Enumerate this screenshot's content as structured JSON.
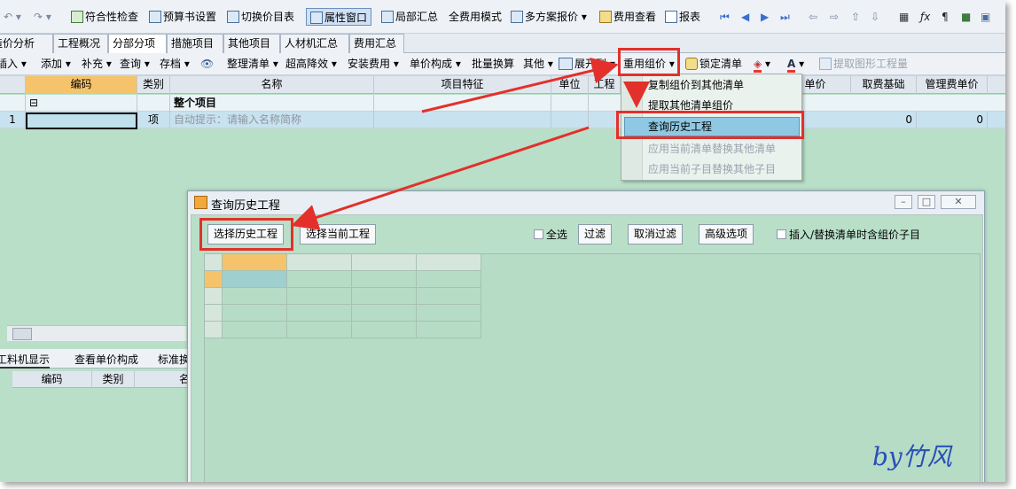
{
  "toolbar1": {
    "compliance_check": "符合性检查",
    "budget_settings": "预算书设置",
    "switch_price_table": "切换价目表",
    "property_window": "属性窗口",
    "partial_summary": "局部汇总",
    "full_fee_mode": "全费用模式",
    "multi_plan_quote": "多方案报价",
    "fee_view": "费用查看",
    "report": "报表"
  },
  "tabs": [
    "造价分析",
    "工程概况",
    "分部分项",
    "措施项目",
    "其他项目",
    "人材机汇总",
    "费用汇总"
  ],
  "toolbar2": {
    "insert": "插入",
    "add": "添加",
    "supplement": "补充",
    "query": "查询",
    "archive": "存档",
    "organize_list": "整理清单",
    "super_height": "超高降效",
    "install_fee": "安装费用",
    "unit_price": "单价构成",
    "batch_convert": "批量换算",
    "other": "其他",
    "expand_to": "展开到",
    "reuse_price": "重用组价",
    "lock_list": "锁定清单",
    "extract_quantity": "提取图形工程量"
  },
  "grid": {
    "headers": [
      "编码",
      "类别",
      "名称",
      "项目特征",
      "单位",
      "工程",
      "单价",
      "取费基础",
      "管理费单价"
    ],
    "row1_name": "整个项目",
    "row2_index": "1",
    "row2_type": "项",
    "row2_hint": "自动提示：请输入名称简称",
    "row2_zero1": "0",
    "row2_zero2": "0"
  },
  "menu": {
    "items": [
      "复制组价到其他清单",
      "提取其他清单组价",
      "查询历史工程",
      "应用当前清单替换其他清单",
      "应用当前子目替换其他子目"
    ]
  },
  "bottom_tabs": [
    "工料机显示",
    "查看单价构成",
    "标准换算"
  ],
  "bottom_grid_headers": [
    "编码",
    "类别",
    "名称"
  ],
  "dialog": {
    "title": "查询历史工程",
    "btn_select_history": "选择历史工程",
    "btn_select_current": "选择当前工程",
    "select_all": "全选",
    "filter": "过滤",
    "cancel_filter": "取消过滤",
    "advanced": "高级选项",
    "insert_replace_option": "插入/替换清单时含组价子目"
  },
  "signature": "by竹风",
  "colors": {
    "annotation_red": "#e3302b",
    "grid_bg": "#b9dfc9",
    "highlight_blue": "#8ec8e2"
  }
}
